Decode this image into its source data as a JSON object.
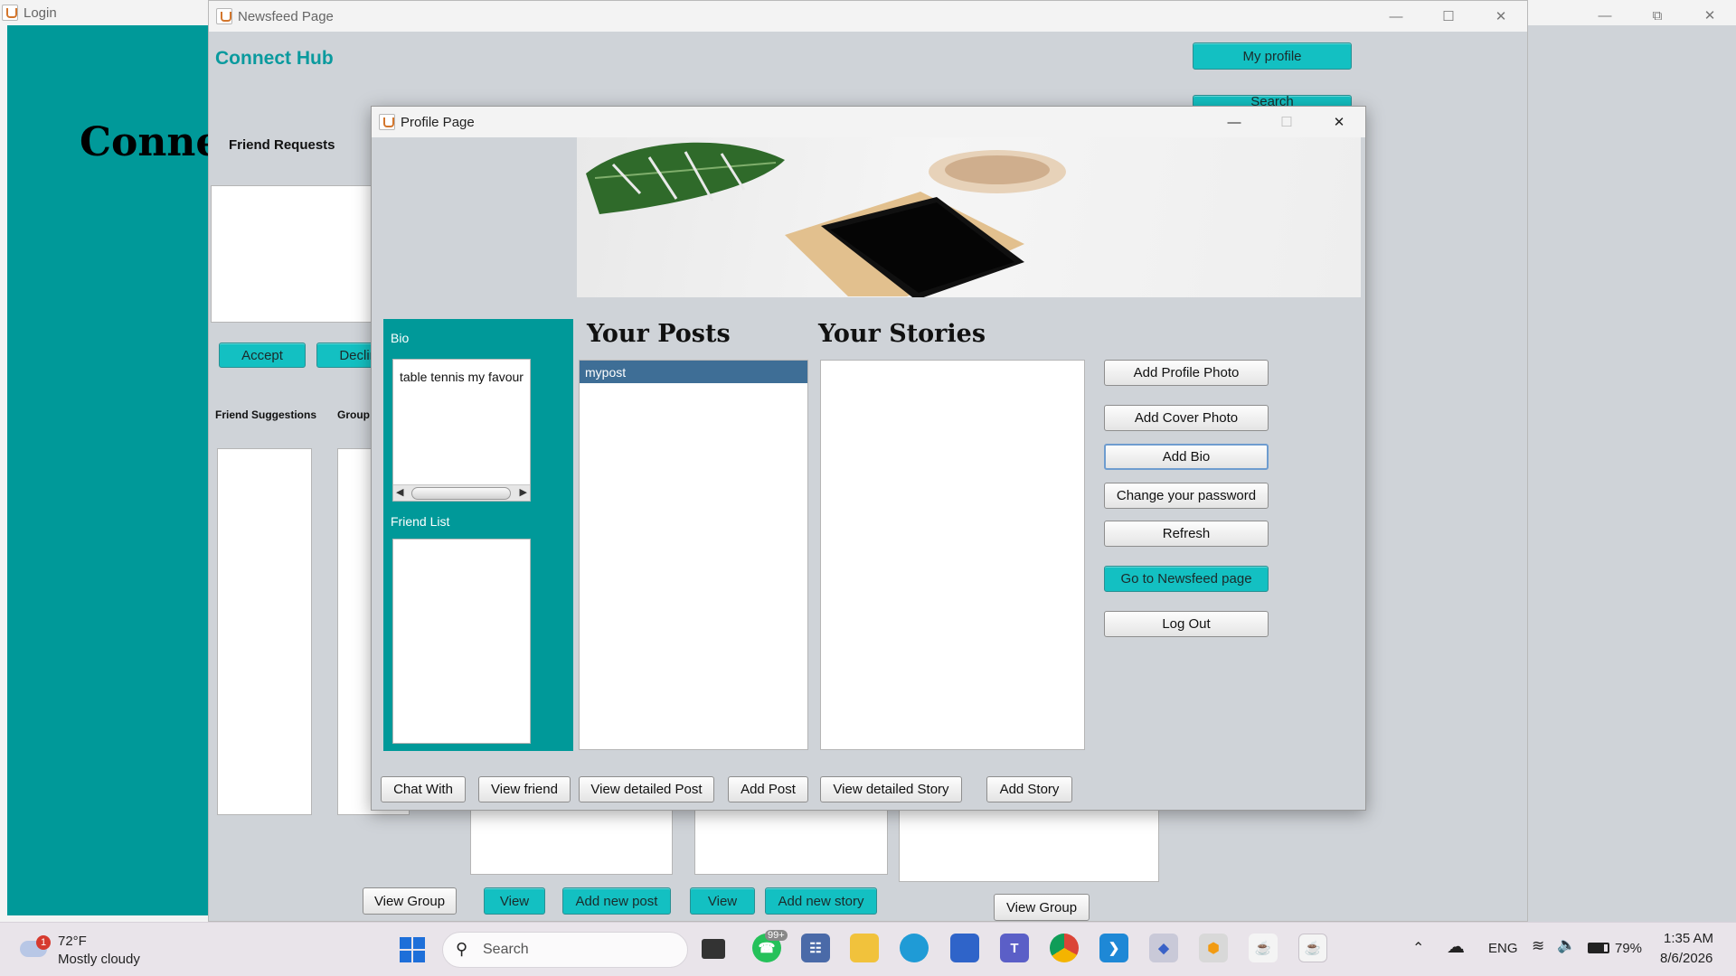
{
  "login_window": {
    "title": "Login",
    "heading": "Connec"
  },
  "newsfeed_window": {
    "title": "Newsfeed Page",
    "brand": "Connect Hub",
    "my_profile": "My profile",
    "search_partial": "Search",
    "friend_requests": "Friend Requests",
    "accept": "Accept",
    "decline": "Declin",
    "friend_suggestions": "Friend Suggestions",
    "groups_partial": "Group",
    "view_group_1": "View Group",
    "view_1": "View",
    "add_new_post": "Add new post",
    "view_2": "View",
    "add_new_story": "Add new story",
    "view_group_2": "View Group"
  },
  "profile_window": {
    "title": "Profile Page",
    "bio_label": "Bio",
    "bio_text": "table tennis my favour",
    "friend_list_label": "Friend List",
    "posts_heading": "Your Posts",
    "stories_heading": "Your Stories",
    "posts": [
      "mypost"
    ],
    "side_buttons": {
      "add_profile_photo": "Add Profile Photo",
      "add_cover_photo": "Add Cover Photo",
      "add_bio": "Add Bio",
      "change_password": "Change your password",
      "refresh": "Refresh",
      "go_newsfeed": "Go to Newsfeed page",
      "log_out": "Log Out"
    },
    "bottom_buttons": {
      "chat_with": "Chat With",
      "view_friend": "View friend",
      "view_detailed_post": "View detailed Post",
      "add_post": "Add Post",
      "view_detailed_story": "View detailed Story",
      "add_story": "Add Story"
    }
  },
  "taskbar": {
    "weather_temp": "72°F",
    "weather_desc": "Mostly cloudy",
    "weather_badge": "1",
    "search_placeholder": "Search",
    "whatsapp_badge": "99+",
    "language": "ENG",
    "battery": "79%",
    "time": "1:35 AM",
    "date": "8/6/2026"
  },
  "colors": {
    "teal": "#009999",
    "button_teal": "#13c0c2",
    "selected_row": "#3e6e96"
  }
}
